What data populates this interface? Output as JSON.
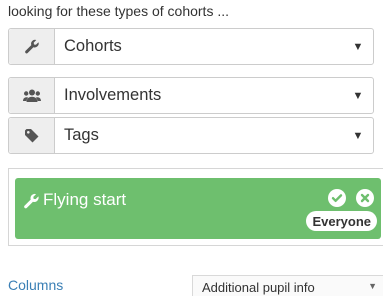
{
  "intro_text": "looking for these types of cohorts ...",
  "filters": [
    {
      "label": "Cohorts",
      "icon": "wrench-icon"
    },
    {
      "label": "Involvements",
      "icon": "users-icon"
    },
    {
      "label": "Tags",
      "icon": "tag-icon"
    }
  ],
  "caret_glyph": "▼",
  "selected_cohort": {
    "title": "Flying start",
    "badge": "Everyone",
    "color": "#6ebf6e"
  },
  "columns_link": "Columns",
  "pupil_select": {
    "value": "Additional pupil info",
    "caret": "▼"
  }
}
